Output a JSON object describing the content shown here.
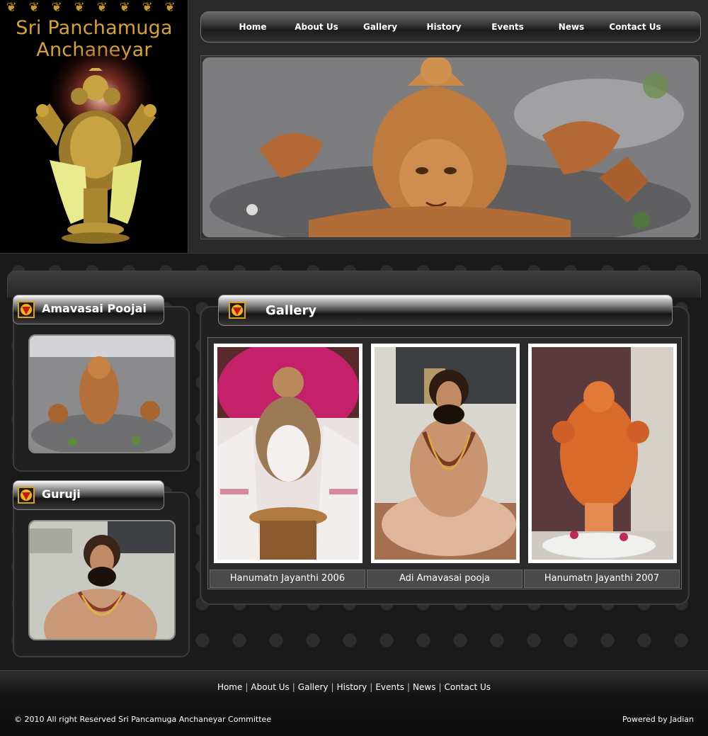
{
  "header": {
    "site_title_line1": "Sri Panchamuga",
    "site_title_line2": "Anchaneyar",
    "ornament_glyph": "❦",
    "brand_color": "#d7a232"
  },
  "nav": {
    "items": [
      {
        "label": "Home"
      },
      {
        "label": "About Us"
      },
      {
        "label": "Gallery"
      },
      {
        "label": "History"
      },
      {
        "label": "Events"
      },
      {
        "label": "News"
      },
      {
        "label": "Contact Us"
      }
    ]
  },
  "sidebar": {
    "boxes": [
      {
        "title": "Amavasai Poojai",
        "icon": "yantra-emblem-icon"
      },
      {
        "title": "Guruji",
        "icon": "yantra-emblem-icon"
      }
    ]
  },
  "gallery": {
    "title": "Gallery",
    "icon": "yantra-emblem-icon",
    "items": [
      {
        "caption": "Hanumatn Jayanthi 2006"
      },
      {
        "caption": "Adi Amavasai pooja"
      },
      {
        "caption": "Hanumatn Jayanthi 2007"
      }
    ]
  },
  "footer": {
    "links": [
      {
        "label": "Home"
      },
      {
        "label": "About Us"
      },
      {
        "label": "Gallery"
      },
      {
        "label": "History"
      },
      {
        "label": "Events"
      },
      {
        "label": "News"
      },
      {
        "label": "Contact Us"
      }
    ],
    "separator": "|",
    "copyright": "© 2010 All right Reserved Sri Pancamuga Anchaneyar Committee",
    "powered_by": "Powered by Jadian"
  }
}
